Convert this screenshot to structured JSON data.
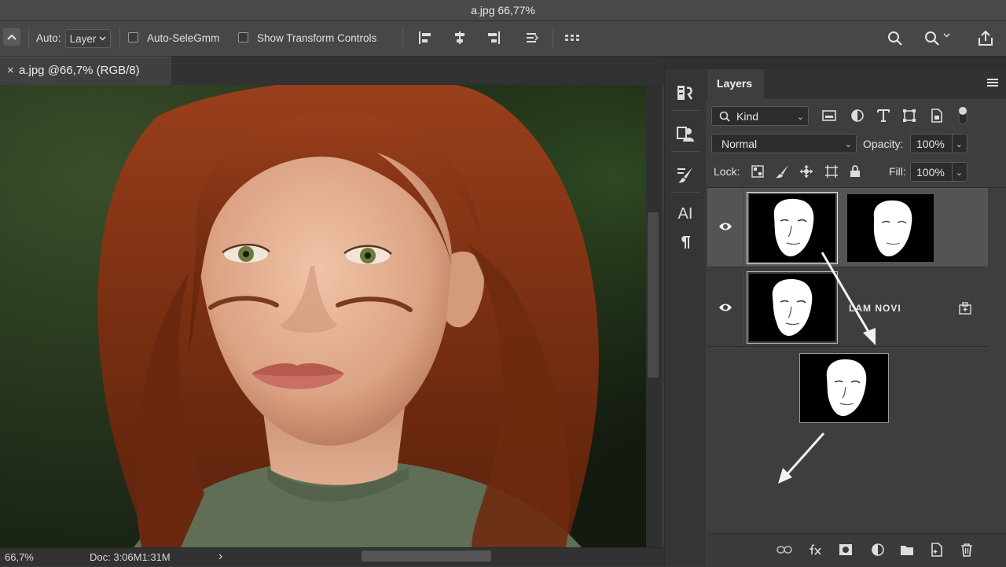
{
  "window": {
    "title": "a.jpg 66,77%"
  },
  "options_bar": {
    "auto_label": "Auto:",
    "auto_select_value": "Layer",
    "auto_select_checkbox_label": "Auto-SeleGmm",
    "show_transform_label": "Show Transform Controls"
  },
  "document": {
    "tab_title": "a.jpg @66,7% (RGB/8)",
    "close_glyph": "×"
  },
  "status_bar": {
    "zoom": "66,7%",
    "doc_info": "Doc: 3:06M1:31M",
    "arrow": "›"
  },
  "tool_strip": {
    "ai_label": "AI"
  },
  "layers_panel": {
    "tab_title": "Layers",
    "filter_kind": "Kind",
    "blend_mode": "Normal",
    "opacity_label": "Opacity:",
    "opacity_value": "100%",
    "lock_label": "Lock:",
    "fill_label": "Fill:",
    "fill_value": "100%",
    "layer2_name": "LAM NOVI"
  },
  "colors": {
    "panel_bg": "#3e3e3e",
    "selected_row": "#545454",
    "app_bg": "#3a3a3a"
  }
}
